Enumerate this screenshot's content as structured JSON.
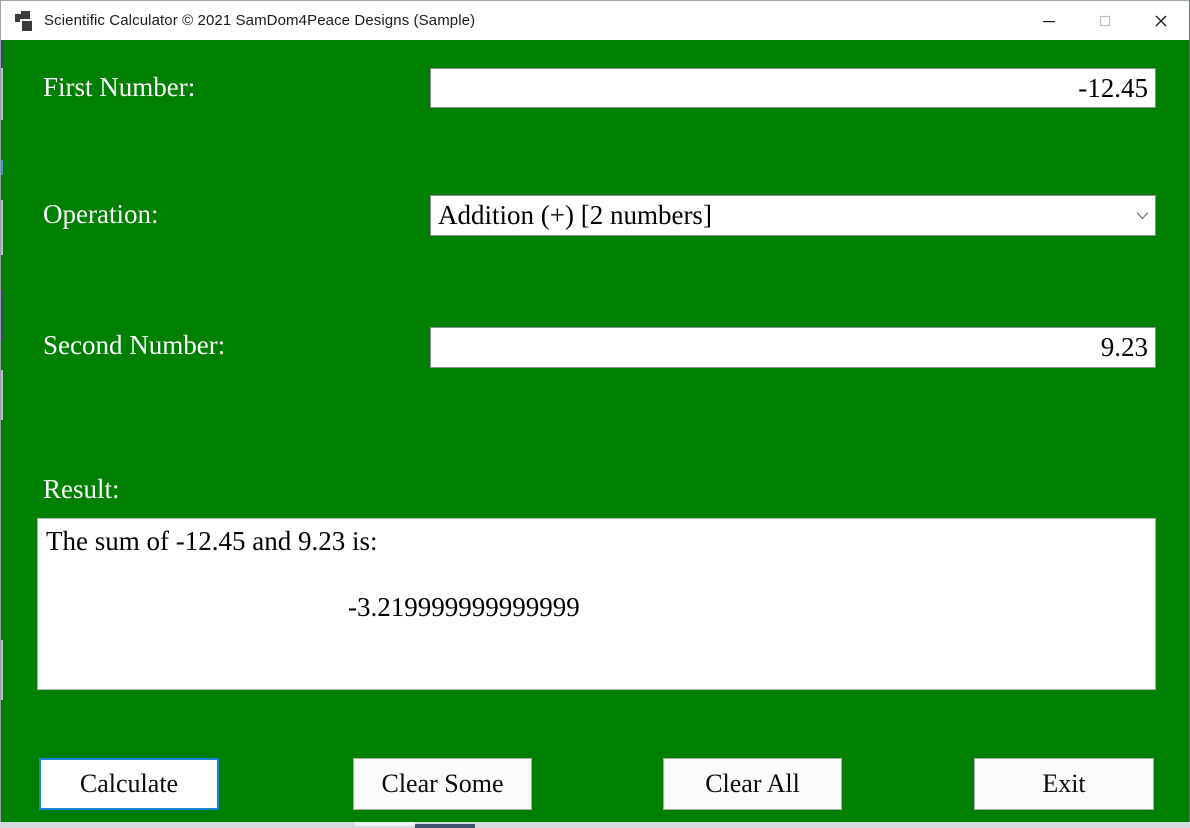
{
  "window": {
    "title": "Scientific Calculator © 2021 SamDom4Peace Designs (Sample)",
    "icon": "app-squares-icon",
    "background_color": "#008000",
    "controls": {
      "minimize": "minimize-icon",
      "maximize": "maximize-icon",
      "close": "close-icon"
    }
  },
  "form": {
    "first_number": {
      "label": "First Number:",
      "value": "-12.45",
      "placeholder": ""
    },
    "operation": {
      "label": "Operation:",
      "selected": "Addition (+) [2 numbers]",
      "chevron": "chevron-down-icon"
    },
    "second_number": {
      "label": "Second Number:",
      "value": "9.23",
      "placeholder": ""
    },
    "result": {
      "label": "Result:",
      "line1": "The sum of -12.45 and 9.23 is:",
      "line2": "-3.219999999999999"
    }
  },
  "buttons": {
    "calculate": "Calculate",
    "clear_some": "Clear Some",
    "clear_all": "Clear All",
    "exit": "Exit",
    "focus_color": "#1883d7"
  }
}
